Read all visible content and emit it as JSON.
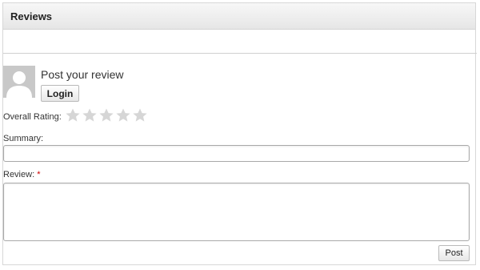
{
  "panel": {
    "title": "Reviews"
  },
  "review_form": {
    "heading": "Post your review",
    "login_label": "Login",
    "rating_label": "Overall Rating:",
    "rating_value": 0,
    "rating_max": 5,
    "summary_label": "Summary:",
    "summary_value": "",
    "review_label": "Review:",
    "review_required_mark": "*",
    "review_value": "",
    "post_label": "Post",
    "avatar_icon": "default-user-avatar-icon",
    "star_icon": "star-icon"
  },
  "colors": {
    "star_empty": "#d6d6d6",
    "required": "#cc0000",
    "avatar_bg": "#c8c8c8"
  }
}
